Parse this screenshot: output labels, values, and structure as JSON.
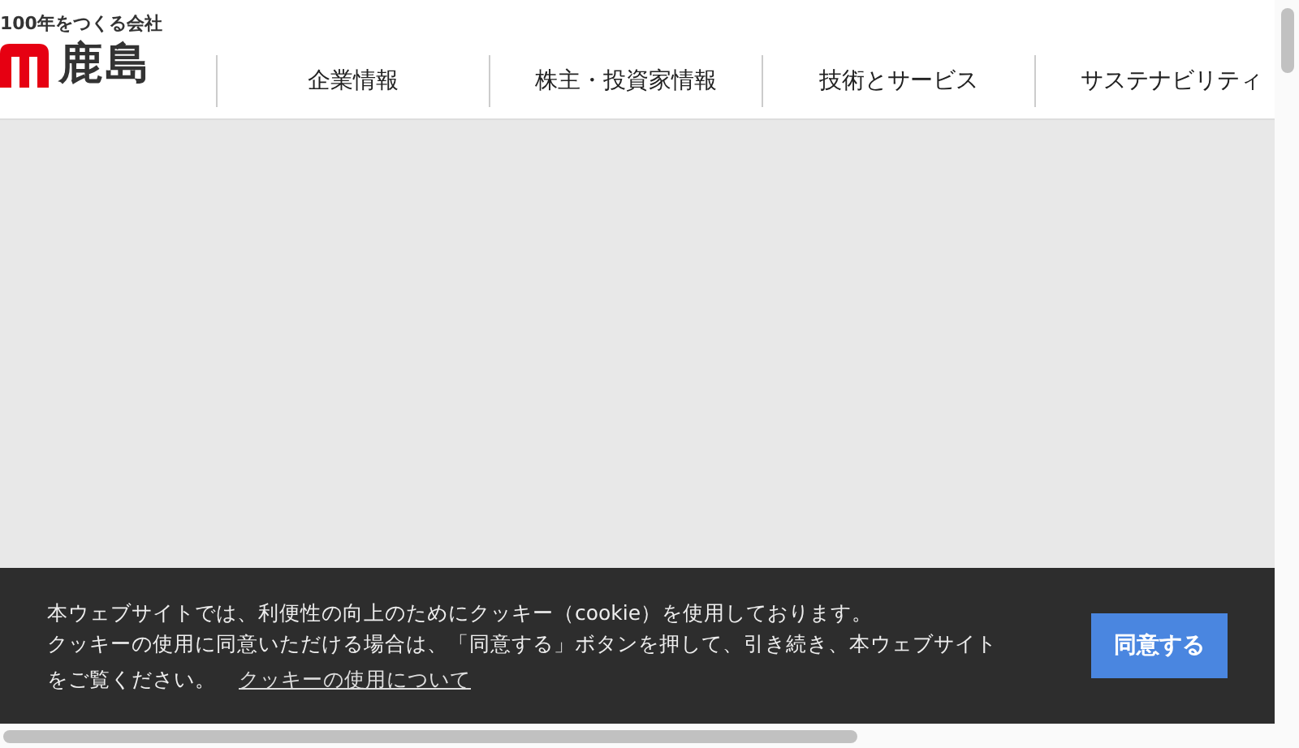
{
  "header": {
    "tagline": "100年をつくる会社",
    "logo_text": "鹿島"
  },
  "nav": [
    {
      "label": "企業情報"
    },
    {
      "label": "株主・投資家情報"
    },
    {
      "label": "技術とサービス"
    },
    {
      "label": "サステナビリティ"
    }
  ],
  "cookie_banner": {
    "lines": [
      "本ウェブサイトでは、利便性の向上のためにクッキー（cookie）を使用しております。",
      "クッキーの使用に同意いただける場合は、「同意する」ボタンを押して、引き続き、本ウェブサイト",
      "をご覧ください。"
    ],
    "link": "クッキーの使用について",
    "button": "同意する"
  }
}
